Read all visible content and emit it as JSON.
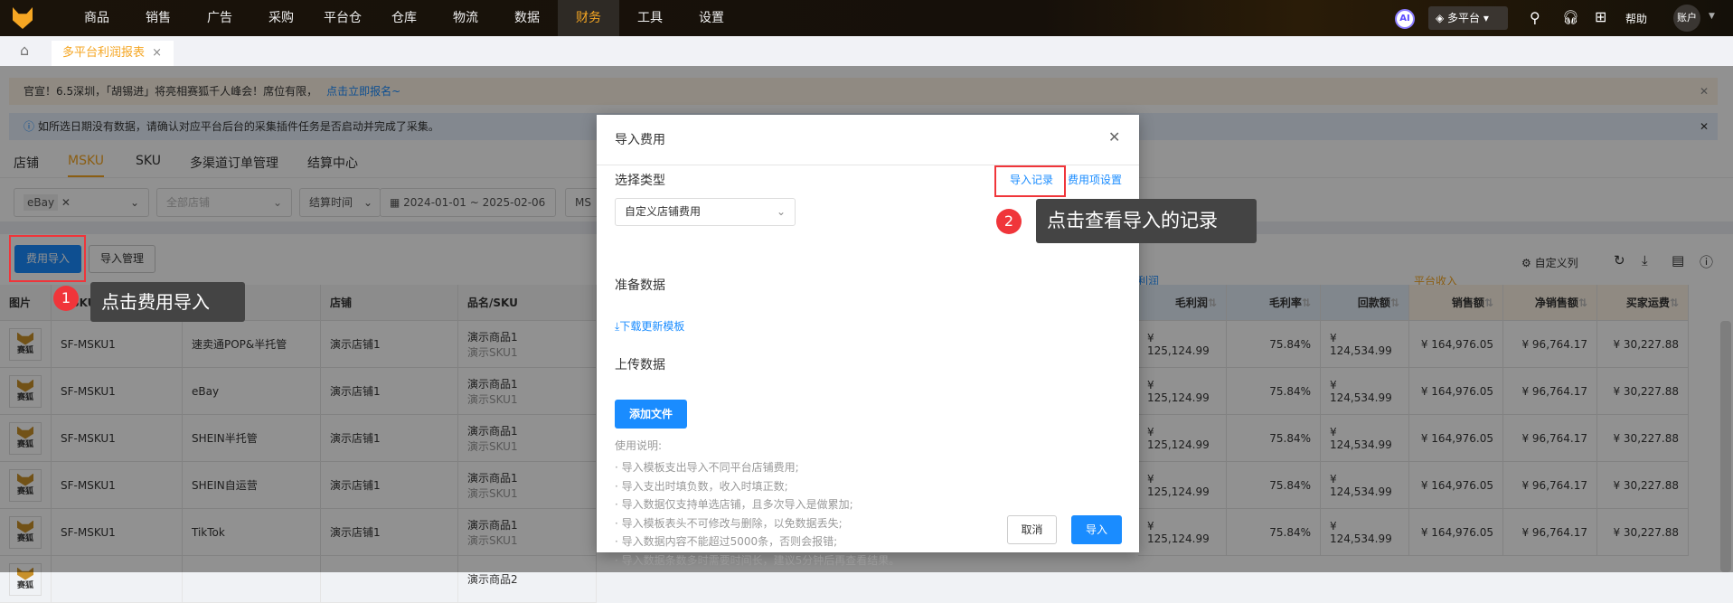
{
  "nav": {
    "items": [
      "商品",
      "销售",
      "广告",
      "采购",
      "平台仓",
      "仓库",
      "物流",
      "数据",
      "财务",
      "工具",
      "设置"
    ],
    "active": "财务",
    "ai": "AI",
    "platform": "多平台",
    "help": "帮助",
    "account": "账户"
  },
  "tabbar": {
    "tab": "多平台利润报表",
    "close": "×"
  },
  "banners": {
    "promo": "官宣！6.5深圳，「胡锡进」将亮相赛狐千人峰会！席位有限，",
    "promo_link": "点击立即报名~",
    "info": "如所选日期没有数据，请确认对应平台后台的采集插件任务是否启动并完成了采集。"
  },
  "tabs": [
    "店铺",
    "MSKU",
    "SKU",
    "多渠道订单管理",
    "结算中心"
  ],
  "filters": {
    "platform_tag": "eBay",
    "shop_placeholder": "全部店铺",
    "time_type": "结算时间",
    "date_range": "2024-01-01 ~ 2025-02-06",
    "msku": "MS"
  },
  "toolbar": {
    "import_fee": "费用导入",
    "import_manage": "导入管理",
    "custom_cols": "自定义列"
  },
  "groups": {
    "profit": "利润",
    "income": "平台收入"
  },
  "table": {
    "left_headers": [
      "图片",
      "MSKU",
      "",
      "店铺",
      "品名/SKU"
    ],
    "right_headers": [
      "毛利润",
      "毛利率",
      "回款额",
      "销售额",
      "净销售额",
      "买家运费"
    ],
    "logo_text": "赛狐",
    "rows": [
      {
        "msku": "SF-MSKU1",
        "platform": "速卖通POP&半托管",
        "shop": "演示店铺1",
        "name": "演示商品1",
        "sku": "演示SKU1"
      },
      {
        "msku": "SF-MSKU1",
        "platform": "eBay",
        "shop": "演示店铺1",
        "name": "演示商品1",
        "sku": "演示SKU1"
      },
      {
        "msku": "SF-MSKU1",
        "platform": "SHEIN半托管",
        "shop": "演示店铺1",
        "name": "演示商品1",
        "sku": "演示SKU1"
      },
      {
        "msku": "SF-MSKU1",
        "platform": "SHEIN自运营",
        "shop": "演示店铺1",
        "name": "演示商品1",
        "sku": "演示SKU1"
      },
      {
        "msku": "SF-MSKU1",
        "platform": "TikTok",
        "shop": "演示店铺1",
        "name": "演示商品1",
        "sku": "演示SKU1"
      },
      {
        "msku": "",
        "platform": "",
        "shop": "",
        "name": "演示商品2",
        "sku": ""
      }
    ],
    "right_values": [
      "¥ 125,124.99",
      "75.84%",
      "¥ 124,534.99",
      "¥ 164,976.05",
      "¥ 96,764.17",
      "¥ 30,227.88"
    ]
  },
  "modal": {
    "title": "导入费用",
    "select_type": "选择类型",
    "import_record": "导入记录",
    "fee_settings": "费用项设置",
    "type_value": "自定义店铺费用",
    "prepare": "准备数据",
    "download": "下载更新模板",
    "upload": "上传数据",
    "add_file": "添加文件",
    "usage_title": "使用说明:",
    "usage": [
      "导入模板支出导入不同平台店铺费用;",
      "导入支出时填负数，收入时填正数;",
      "导入数据仅支持单选店铺，且多次导入是做累加;",
      "导入模板表头不可修改与删除，以免数据丢失;",
      "导入数据内容不能超过5000条，否则会报错;",
      "导入数据条数多时需要时间长，建议5分钟后再查看结果。"
    ],
    "cancel": "取消",
    "import": "导入"
  },
  "tips": {
    "step1": "1",
    "tip1": "点击费用导入",
    "step2": "2",
    "tip2": "点击查看导入的记录"
  },
  "colors": {
    "accent": "#f5a623",
    "primary": "#1a8cff",
    "red": "#f0353a"
  }
}
